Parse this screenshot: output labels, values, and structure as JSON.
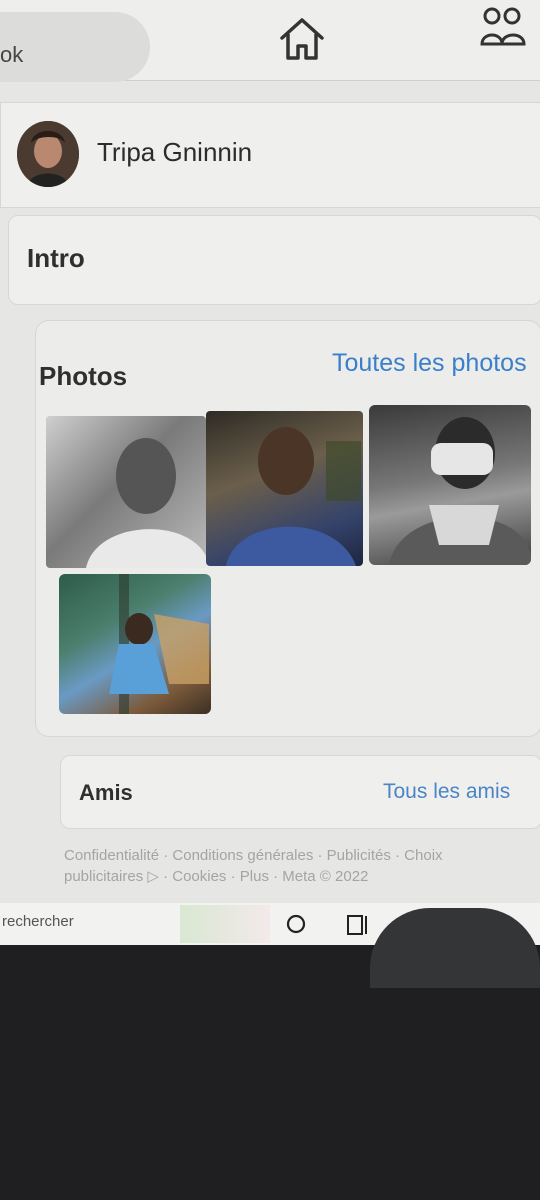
{
  "header": {
    "search_text": "ok",
    "home_icon": "home-icon",
    "friends_icon": "friends-icon"
  },
  "profile": {
    "name": "Tripa Gninnin"
  },
  "intro": {
    "title": "Intro"
  },
  "photos": {
    "title": "Photos",
    "all_link": "Toutes les photos",
    "items": [
      "photo-1",
      "photo-2",
      "photo-3",
      "photo-4"
    ]
  },
  "friends": {
    "title": "Amis",
    "all_link": "Tous les amis"
  },
  "footer": {
    "text": "Confidentialité · Conditions générales · Publicités · Choix publicitaires ▷ · Cookies · Plus · Meta © 2022"
  },
  "taskbar": {
    "search_text": "rechercher"
  },
  "colors": {
    "link": "#3a7fc9",
    "page_bg": "#e6e6e4"
  }
}
